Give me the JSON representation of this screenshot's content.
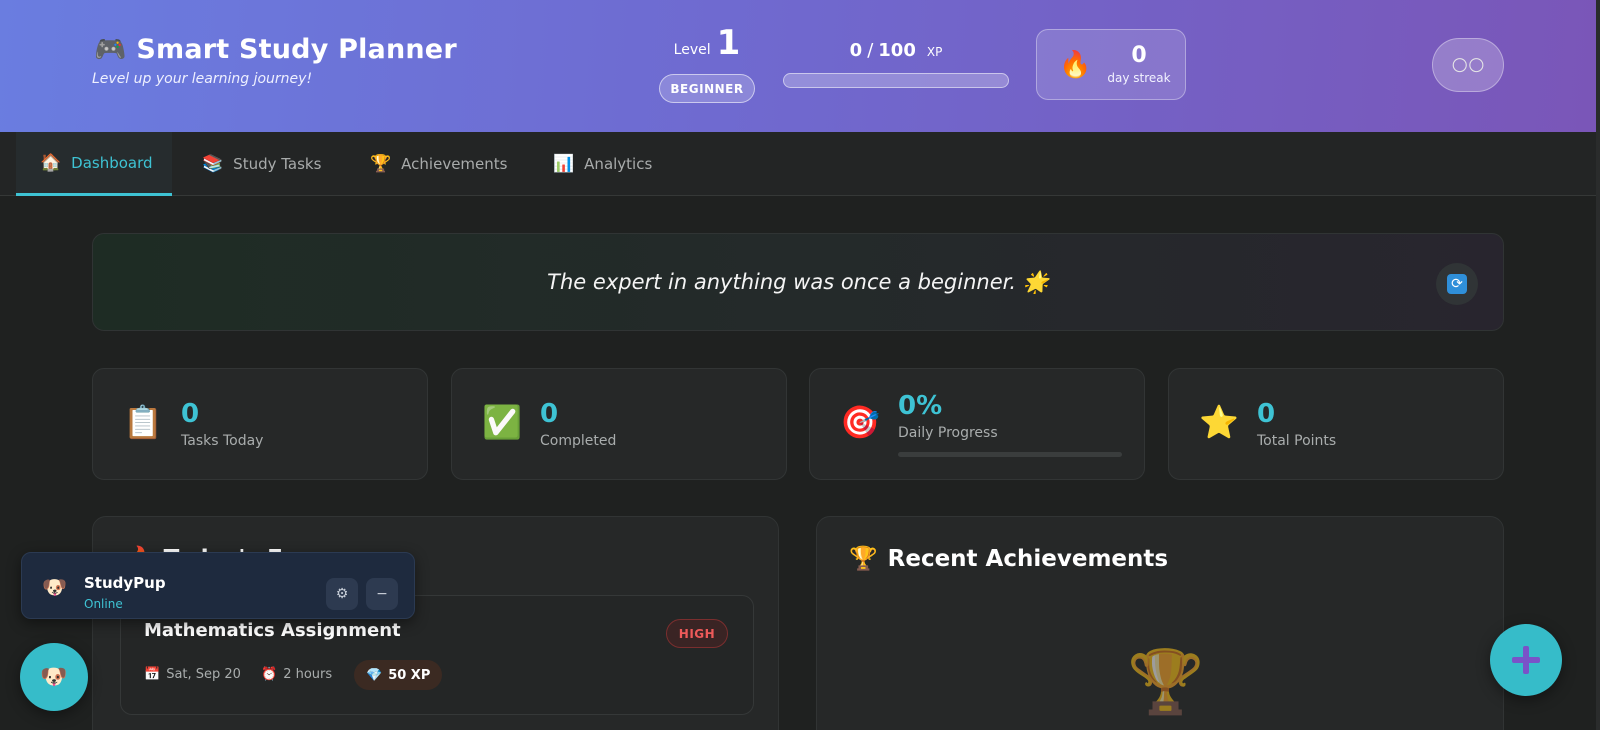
{
  "header": {
    "app_icon": "game-controller-icon",
    "app_icon_glyph": "🎮",
    "title": "Smart Study Planner",
    "subtitle": "Level up your learning journey!",
    "level_label": "Level",
    "level_value": "1",
    "rank": "BEGINNER",
    "xp_current": "0",
    "xp_sep": "/",
    "xp_max": "100",
    "xp_unit": "XP",
    "xp_progress": 0,
    "streak_icon": "🔥",
    "streak_value": "0",
    "streak_label": "day streak",
    "theme_toggle_glyph": "🌕🌕"
  },
  "tabs": [
    {
      "label": "Dashboard",
      "icon": "home-icon",
      "glyph": "🏠",
      "active": true
    },
    {
      "label": "Study Tasks",
      "icon": "books-icon",
      "glyph": "📚",
      "active": false
    },
    {
      "label": "Achievements",
      "icon": "trophy-icon",
      "glyph": "🏆",
      "active": false
    },
    {
      "label": "Analytics",
      "icon": "bar-chart-icon",
      "glyph": "📊",
      "active": false
    }
  ],
  "quote": {
    "text": "The expert in anything was once a beginner. 🌟",
    "refresh_icon": "refresh-icon",
    "refresh_glyph": "🔄"
  },
  "stats": [
    {
      "value": "0",
      "label": "Tasks Today",
      "icon": "clipboard-icon",
      "glyph": "📋"
    },
    {
      "value": "0",
      "label": "Completed",
      "icon": "check-icon",
      "glyph": "✅"
    },
    {
      "value": "0%",
      "label": "Daily Progress",
      "icon": "target-icon",
      "glyph": "🎯",
      "progress": 0
    },
    {
      "value": "0",
      "label": "Total Points",
      "icon": "star-icon",
      "glyph": "⭐"
    }
  ],
  "focus_panel": {
    "title_icon": "fire-icon",
    "title_glyph": "🔥",
    "title": "Today's Focus",
    "task": {
      "title": "Mathematics Assignment",
      "priority": "HIGH",
      "date_glyph": "📅",
      "date": "Sat, Sep 20",
      "duration_glyph": "⏰",
      "duration": "2 hours",
      "xp_glyph": "💎",
      "xp": "50 XP"
    }
  },
  "achievements_panel": {
    "title_glyph": "🏆",
    "title": "Recent Achievements",
    "empty_glyph": "🏆"
  },
  "chat": {
    "avatar_glyph": "🐶",
    "name": "StudyPup",
    "status": "Online",
    "settings_glyph": "⚙",
    "minimize_glyph": "−"
  },
  "colors": {
    "accent": "#3ec3d4",
    "header_start": "#6a7de0",
    "header_end": "#7a56b8",
    "priority_high": "#ee5a5a"
  }
}
